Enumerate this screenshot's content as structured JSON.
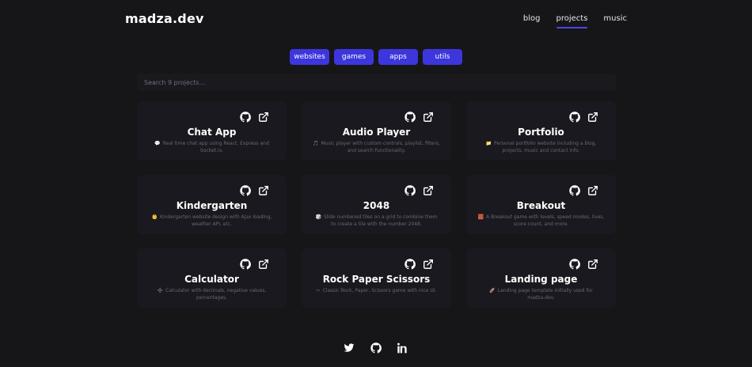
{
  "header": {
    "logo": "madza.dev",
    "nav": [
      {
        "label": "blog",
        "active": false
      },
      {
        "label": "projects",
        "active": true
      },
      {
        "label": "music",
        "active": false
      }
    ]
  },
  "filters": [
    {
      "label": "websites"
    },
    {
      "label": "games"
    },
    {
      "label": "apps"
    },
    {
      "label": "utils"
    }
  ],
  "search": {
    "placeholder": "Search 9 projects..."
  },
  "projects": [
    {
      "title": "Chat App",
      "emoji": "💬",
      "description": "Real time chat app using React, Express and Socket.io."
    },
    {
      "title": "Audio Player",
      "emoji": "🎵",
      "description": "Music player with custom controls, playlist, filters, and search functionality."
    },
    {
      "title": "Portfolio",
      "emoji": "📁",
      "description": "Personal portfolio website including a blog, projects, music and contact info."
    },
    {
      "title": "Kindergarten",
      "emoji": "👶",
      "description": "Kindergarten website design with Ajax loading, weather API, etc."
    },
    {
      "title": "2048",
      "emoji": "🎲",
      "description": "Slide numbered tiles on a grid to combine them to create a tile with the number 2048."
    },
    {
      "title": "Breakout",
      "emoji": "🧱",
      "description": "A Breakout game with levels, speed modes, lives, score count, and more."
    },
    {
      "title": "Calculator",
      "emoji": "➗",
      "description": "Calculator with decimals, negative values, percentages."
    },
    {
      "title": "Rock Paper Scissors",
      "emoji": "✂",
      "description": "Classic Rock, Paper, Scissors game with nice UI."
    },
    {
      "title": "Landing page",
      "emoji": "🚀",
      "description": "Landing page template initially used for madza.dev."
    }
  ],
  "socials": [
    {
      "icon": "twitter-icon"
    },
    {
      "icon": "github-icon"
    },
    {
      "icon": "linkedin-icon"
    }
  ],
  "colors": {
    "background": "#161619",
    "card": "#19191f",
    "accent": "#3d36dc",
    "nav_underline": "#4f46e5"
  }
}
